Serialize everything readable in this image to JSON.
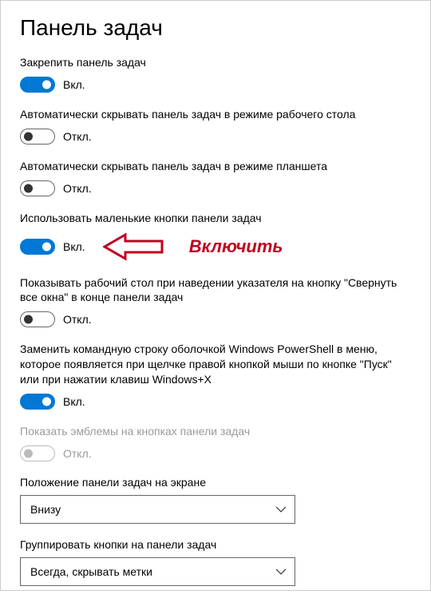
{
  "title": "Панель задач",
  "state_on": "Вкл.",
  "state_off": "Откл.",
  "callout_text": "Включить",
  "settings": {
    "lock": {
      "label": "Закрепить панель задач",
      "on": true
    },
    "hide_desktop": {
      "label": "Автоматически скрывать панель задач в режиме рабочего стола",
      "on": false
    },
    "hide_tablet": {
      "label": "Автоматически скрывать панель задач в режиме планшета",
      "on": false
    },
    "small_buttons": {
      "label": "Использовать маленькие кнопки панели задач",
      "on": true
    },
    "peek": {
      "label": "Показывать рабочий стол при наведении указателя на кнопку \"Свернуть все окна\" в конце панели задач",
      "on": false
    },
    "powershell": {
      "label": "Заменить командную строку оболочкой Windows PowerShell в меню, которое появляется при щелчке правой кнопкой мыши по кнопке \"Пуск\" или при нажатии клавиш Windows+X",
      "on": true
    },
    "badges": {
      "label": "Показать эмблемы на кнопках панели задач",
      "on": false,
      "disabled": true
    }
  },
  "dropdowns": {
    "position": {
      "label": "Положение панели задач на экране",
      "value": "Внизу"
    },
    "grouping": {
      "label": "Группировать кнопки на панели задач",
      "value": "Всегда, скрывать метки"
    }
  }
}
